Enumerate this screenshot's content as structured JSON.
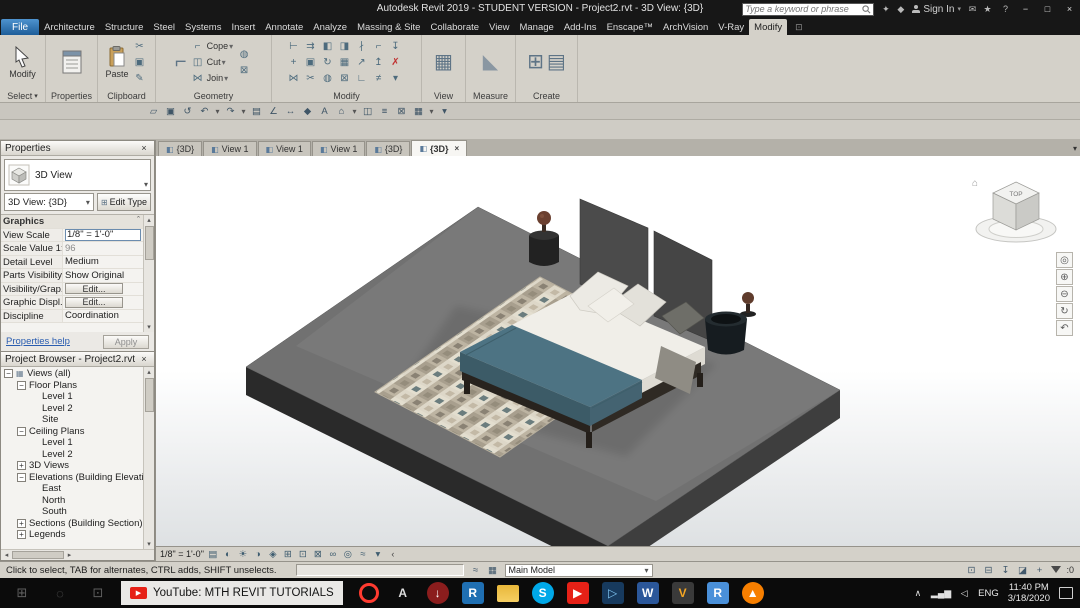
{
  "glyphs": {
    "caret_down": "▾",
    "close": "×",
    "chevron_up": "ˆ",
    "tri_up": "▴",
    "tri_down": "▾",
    "tri_left": "◂",
    "tri_right": "▸",
    "scroll_left": "‹"
  },
  "titlebar": {
    "title": "Autodesk Revit 2019 - STUDENT VERSION - Project2.rvt - 3D View: {3D}",
    "search_placeholder": "Type a keyword or phrase",
    "sign_in_label": "Sign In",
    "help_glyph": "?",
    "minimize_glyph": "−",
    "maximize_glyph": "□",
    "close_glyph": "×",
    "icons_pre_signin": [
      {
        "name": "autodesk-id-icon",
        "glyph": "✦"
      },
      {
        "name": "exchange-apps-icon",
        "glyph": "◆"
      }
    ],
    "icons_post_signin": [
      {
        "name": "communication-center-icon",
        "glyph": "✉"
      },
      {
        "name": "favorites-icon",
        "glyph": "★"
      }
    ]
  },
  "ribbon_tabs": {
    "file_label": "File",
    "items": [
      "Architecture",
      "Structure",
      "Steel",
      "Systems",
      "Insert",
      "Annotate",
      "Analyze",
      "Massing & Site",
      "Collaborate",
      "View",
      "Manage",
      "Add-Ins",
      "Enscape™",
      "ArchVision",
      "V-Ray",
      "Modify"
    ],
    "active": "Modify",
    "modify_state_glyph": "⊡"
  },
  "ribbon_panels": {
    "select": {
      "label": "Select",
      "modify_label": "Modify"
    },
    "properties": {
      "label": "Properties"
    },
    "clipboard": {
      "label": "Clipboard",
      "paste_label": "Paste",
      "small_icons": [
        {
          "name": "cut-to-clipboard-icon",
          "glyph": "✂"
        },
        {
          "name": "copy-to-clipboard-icon",
          "glyph": "▣"
        },
        {
          "name": "match-type-icon",
          "glyph": "✎"
        }
      ]
    },
    "geometry": {
      "label": "Geometry",
      "big_icon_glyph": "⌐",
      "rows": [
        {
          "name": "cope-button",
          "label": "Cope",
          "glyph": "⌐"
        },
        {
          "name": "cut-button",
          "label": "Cut",
          "glyph": "◫"
        },
        {
          "name": "join-button",
          "label": "Join",
          "glyph": "⋈"
        }
      ],
      "extra_icons": [
        {
          "name": "paint-icon",
          "glyph": "◍"
        },
        {
          "name": "demolish-icon",
          "glyph": "⊠"
        }
      ]
    },
    "modify": {
      "label": "Modify",
      "grid": [
        {
          "name": "align-icon",
          "glyph": "⊢"
        },
        {
          "name": "offset-icon",
          "glyph": "⇉"
        },
        {
          "name": "mirror-pick-axis-icon",
          "glyph": "◧"
        },
        {
          "name": "mirror-draw-axis-icon",
          "glyph": "◨"
        },
        {
          "name": "split-element-icon",
          "glyph": "∤"
        },
        {
          "name": "trim-extend-icon",
          "glyph": "⌐"
        },
        {
          "name": "pin-icon",
          "glyph": "↧"
        },
        {
          "name": "move-icon",
          "glyph": "+"
        },
        {
          "name": "copy-icon",
          "glyph": "▣"
        },
        {
          "name": "rotate-icon",
          "glyph": "↻"
        },
        {
          "name": "array-icon",
          "glyph": "▦"
        },
        {
          "name": "scale-icon",
          "glyph": "↗"
        },
        {
          "name": "unpin-icon",
          "glyph": "↥"
        },
        {
          "name": "delete-icon",
          "glyph": "✗",
          "color": "#c03030"
        },
        {
          "name": "join-geometry-icon",
          "glyph": "⋈"
        },
        {
          "name": "cut-geometry-icon",
          "glyph": "✂"
        },
        {
          "name": "paint-surface-icon",
          "glyph": "◍"
        },
        {
          "name": "demolish-element-icon",
          "glyph": "⊠"
        },
        {
          "name": "wall-joins-icon",
          "glyph": "∟"
        },
        {
          "name": "beam-coping-icon",
          "glyph": "≠"
        },
        {
          "name": "more-tools-icon",
          "glyph": "▾"
        }
      ]
    },
    "view": {
      "label": "View",
      "icon_glyph": "▦"
    },
    "measure": {
      "label": "Measure",
      "icon_glyph": "◣"
    },
    "create": {
      "label": "Create",
      "icon_glyphs": [
        {
          "name": "create-group-icon",
          "glyph": "⊞"
        },
        {
          "name": "create-similar-icon",
          "glyph": "▤"
        }
      ]
    }
  },
  "qat_icons": [
    {
      "name": "open-icon",
      "glyph": "▱"
    },
    {
      "name": "save-icon",
      "glyph": "▣"
    },
    {
      "name": "sync-with-central-icon",
      "glyph": "↺"
    },
    {
      "name": "undo-icon",
      "glyph": "↶",
      "caret": true
    },
    {
      "name": "redo-icon",
      "glyph": "↷",
      "caret": true
    },
    {
      "name": "print-icon",
      "glyph": "▤"
    },
    {
      "name": "measure-icon",
      "glyph": "∠"
    },
    {
      "name": "aligned-dimension-icon",
      "glyph": "↔"
    },
    {
      "name": "tag-by-category-icon",
      "glyph": "◆"
    },
    {
      "name": "text-icon",
      "glyph": "A"
    },
    {
      "name": "default-3d-view-icon",
      "glyph": "⌂",
      "caret": true
    },
    {
      "name": "section-icon",
      "glyph": "◫"
    },
    {
      "name": "thin-lines-icon",
      "glyph": "≡"
    },
    {
      "name": "close-inactive-windows-icon",
      "glyph": "⊠"
    },
    {
      "name": "switch-windows-icon",
      "glyph": "▦",
      "caret": true
    },
    {
      "name": "customize-qat-icon",
      "glyph": "▾"
    }
  ],
  "view_tabs": [
    {
      "label": "{3D}",
      "active": false
    },
    {
      "label": "View 1",
      "active": false
    },
    {
      "label": "View 1",
      "active": false
    },
    {
      "label": "View 1",
      "active": false
    },
    {
      "label": "{3D}",
      "active": false
    },
    {
      "label": "{3D}",
      "active": true
    }
  ],
  "properties": {
    "title": "Properties",
    "type_selector": "3D View",
    "instance_selector": "3D View: {3D}",
    "edit_type_label": "Edit Type",
    "edit_type_icon_glyph": "⊞",
    "section": "Graphics",
    "rows": [
      {
        "label": "View Scale",
        "value": "1/8\" = 1'-0\"",
        "kind": "input"
      },
      {
        "label": "Scale Value    1:",
        "value": "96",
        "kind": "disabled"
      },
      {
        "label": "Detail Level",
        "value": "Medium",
        "kind": "text"
      },
      {
        "label": "Parts Visibility",
        "value": "Show Original",
        "kind": "text"
      },
      {
        "label": "Visibility/Grap...",
        "value": "Edit...",
        "kind": "button"
      },
      {
        "label": "Graphic Displ...",
        "value": "Edit...",
        "kind": "button"
      },
      {
        "label": "Discipline",
        "value": "Coordination",
        "kind": "text"
      }
    ],
    "help_link": "Properties help",
    "apply_label": "Apply"
  },
  "project_browser": {
    "title": "Project Browser - Project2.rvt",
    "tree": [
      {
        "label": "Views (all)",
        "level": 0,
        "expander": "minus",
        "icon_glyph": "▦"
      },
      {
        "label": "Floor Plans",
        "level": 1,
        "expander": "minus"
      },
      {
        "label": "Level 1",
        "level": 2
      },
      {
        "label": "Level 2",
        "level": 2
      },
      {
        "label": "Site",
        "level": 2
      },
      {
        "label": "Ceiling Plans",
        "level": 1,
        "expander": "minus"
      },
      {
        "label": "Level 1",
        "level": 2
      },
      {
        "label": "Level 2",
        "level": 2
      },
      {
        "label": "3D Views",
        "level": 1,
        "expander": "plus"
      },
      {
        "label": "Elevations (Building Elevatio",
        "level": 1,
        "expander": "minus"
      },
      {
        "label": "East",
        "level": 2
      },
      {
        "label": "North",
        "level": 2
      },
      {
        "label": "South",
        "level": 2
      },
      {
        "label": "Sections (Building Section)",
        "level": 1,
        "expander": "plus"
      },
      {
        "label": "Legends",
        "level": 1,
        "expander": "plus"
      }
    ]
  },
  "viewport": {
    "nav_icons": [
      {
        "name": "navigation-wheel-icon",
        "glyph": "◎"
      },
      {
        "name": "zoom-in-icon",
        "glyph": "⊕"
      },
      {
        "name": "zoom-out-icon",
        "glyph": "⊖"
      },
      {
        "name": "orbit-icon",
        "glyph": "↻"
      },
      {
        "name": "rewind-icon",
        "glyph": "↶"
      }
    ]
  },
  "viewcube": {
    "top_label": "TOP",
    "home_glyph": "⌂"
  },
  "view_controls": {
    "scale_label": "1/8\" = 1'-0\"",
    "icons": [
      {
        "name": "detail-level-icon",
        "glyph": "▤"
      },
      {
        "name": "visual-style-icon",
        "glyph": "◐"
      },
      {
        "name": "sun-path-icon",
        "glyph": "☀"
      },
      {
        "name": "shadows-icon",
        "glyph": "◑"
      },
      {
        "name": "render-icon",
        "glyph": "◈"
      },
      {
        "name": "crop-view-icon",
        "glyph": "⊞"
      },
      {
        "name": "show-crop-region-icon",
        "glyph": "⊡"
      },
      {
        "name": "lock-3d-view-icon",
        "glyph": "⊠"
      },
      {
        "name": "temporary-hide-isolate-icon",
        "glyph": "∞"
      },
      {
        "name": "reveal-hidden-elements-icon",
        "glyph": "◎"
      },
      {
        "name": "worksharing-display-icon",
        "glyph": "≈"
      },
      {
        "name": "view-properties-icon",
        "glyph": "▾"
      }
    ],
    "scroll_left_glyph": "‹"
  },
  "statusbar": {
    "hint": "Click to select, TAB for alternates, CTRL adds, SHIFT unselects.",
    "mid_icons": [
      {
        "name": "worksets-icon",
        "glyph": "≈"
      },
      {
        "name": "design-options-icon",
        "glyph": "▦"
      }
    ],
    "main_model_label": "Main Model",
    "right_icons": [
      {
        "name": "select-links-icon",
        "glyph": "⊡"
      },
      {
        "name": "select-underlay-icon",
        "glyph": "⊟"
      },
      {
        "name": "select-pinned-icon",
        "glyph": "↧"
      },
      {
        "name": "select-by-face-icon",
        "glyph": "◪"
      },
      {
        "name": "drag-on-selection-icon",
        "glyph": "+"
      }
    ],
    "filter_count": ":0"
  },
  "taskbar": {
    "start_icons": [
      {
        "name": "start-button-icon",
        "glyph": "⊞"
      },
      {
        "name": "taskbar-search-icon",
        "glyph": "◌"
      },
      {
        "name": "task-view-icon",
        "glyph": "⊡"
      }
    ],
    "active_window": "YouTube: MTH REVIT TUTORIALS",
    "youtube_badge_glyph": "▶",
    "apps": [
      {
        "name": "opera-icon",
        "shape": "ring",
        "fg": "#ff3b30"
      },
      {
        "name": "ime-language-icon",
        "shape": "square",
        "glyph": "A",
        "fg": "#dddddd"
      },
      {
        "name": "downloader-icon",
        "shape": "circle",
        "glyph": "↓",
        "bg": "#8b1d1d",
        "fg": "#ffffff"
      },
      {
        "name": "revit-icon",
        "shape": "square",
        "glyph": "R",
        "bg": "#1f6fb2",
        "fg": "#ffffff"
      },
      {
        "name": "file-explorer-icon",
        "shape": "folder"
      },
      {
        "name": "skype-icon",
        "shape": "circle",
        "glyph": "S",
        "bg": "#00a8e8",
        "fg": "#ffffff"
      },
      {
        "name": "youtube-icon",
        "shape": "square",
        "glyph": "▶",
        "bg": "#e62117",
        "fg": "#ffffff"
      },
      {
        "name": "media-player-icon",
        "shape": "square",
        "glyph": "▷",
        "bg": "#173a5e",
        "fg": "#7ec3f0"
      },
      {
        "name": "word-icon",
        "shape": "square",
        "glyph": "W",
        "bg": "#2b579a",
        "fg": "#ffffff"
      },
      {
        "name": "vray-icon",
        "shape": "square",
        "glyph": "V",
        "bg": "#3a3a3a",
        "fg": "#f5a623"
      },
      {
        "name": "revit-viewer-icon",
        "shape": "square",
        "glyph": "R",
        "bg": "#4a90d9",
        "fg": "#ffffff"
      },
      {
        "name": "vlc-icon",
        "shape": "circle",
        "glyph": "▲",
        "bg": "#f77f00",
        "fg": "#ffffff"
      }
    ],
    "tray_icons": [
      {
        "name": "tray-expand-icon",
        "glyph": "∧"
      },
      {
        "name": "network-icon",
        "glyph": "▂▄▆"
      },
      {
        "name": "volume-icon",
        "glyph": "◁"
      }
    ],
    "language": "ENG",
    "time": "11:40 PM",
    "date": "3/18/2020",
    "accent_close": "#e62117"
  },
  "scene": {
    "platform_top": "#717171",
    "platform_left": "#2a2a2a",
    "platform_right": "#3e3e3e",
    "mattress": "#f0eee8",
    "mattress_side": "#dedbd3",
    "blanket": "#4d7383",
    "blanket_side": "#3c5b67",
    "headboard": "#4b4b4b",
    "frame": "#2f2a24",
    "pot": "#161c20",
    "lamp": "#6b4030"
  }
}
